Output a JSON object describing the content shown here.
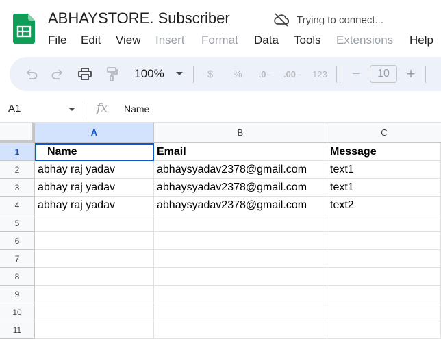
{
  "header": {
    "title": "ABHAYSTORE. Subscriber",
    "connection_status": "Trying to connect...",
    "menus": [
      {
        "label": "File",
        "disabled": false
      },
      {
        "label": "Edit",
        "disabled": false
      },
      {
        "label": "View",
        "disabled": false
      },
      {
        "label": "Insert",
        "disabled": true
      },
      {
        "label": "Format",
        "disabled": true
      },
      {
        "label": "Data",
        "disabled": false
      },
      {
        "label": "Tools",
        "disabled": false
      },
      {
        "label": "Extensions",
        "disabled": true
      },
      {
        "label": "Help",
        "disabled": false
      }
    ]
  },
  "toolbar": {
    "zoom": "100%",
    "currency": "$",
    "percent": "%",
    "decrease_decimal": ".0",
    "increase_decimal": ".00",
    "number_format": "123",
    "font_size": "10",
    "minus": "−",
    "plus": "+"
  },
  "formula_bar": {
    "cell_ref": "A1",
    "fx": "fx",
    "content": "Name"
  },
  "sheet": {
    "columns": [
      "A",
      "B",
      "C"
    ],
    "row_numbers": [
      "1",
      "2",
      "3",
      "4",
      "5",
      "6",
      "7",
      "8",
      "9",
      "10",
      "11"
    ],
    "rows": [
      [
        "Name",
        "Email",
        "Message"
      ],
      [
        "abhay raj yadav",
        "abhaysyadav2378@gmail.com",
        "text1"
      ],
      [
        "abhay raj yadav",
        "abhaysyadav2378@gmail.com",
        "text1"
      ],
      [
        "abhay raj yadav",
        "abhaysyadav2378@gmail.com",
        "text2"
      ]
    ],
    "selected_cell": "A1"
  },
  "colors": {
    "accent": "#0b57d0",
    "selection_header": "#d3e3fd",
    "toolbar_bg": "#edf2fa",
    "sheets_green": "#0f9d58"
  },
  "icons": [
    "sheets-logo",
    "cloud-offline-icon",
    "undo-icon",
    "redo-icon",
    "print-icon",
    "paint-format-icon",
    "dropdown-caret-icon"
  ]
}
